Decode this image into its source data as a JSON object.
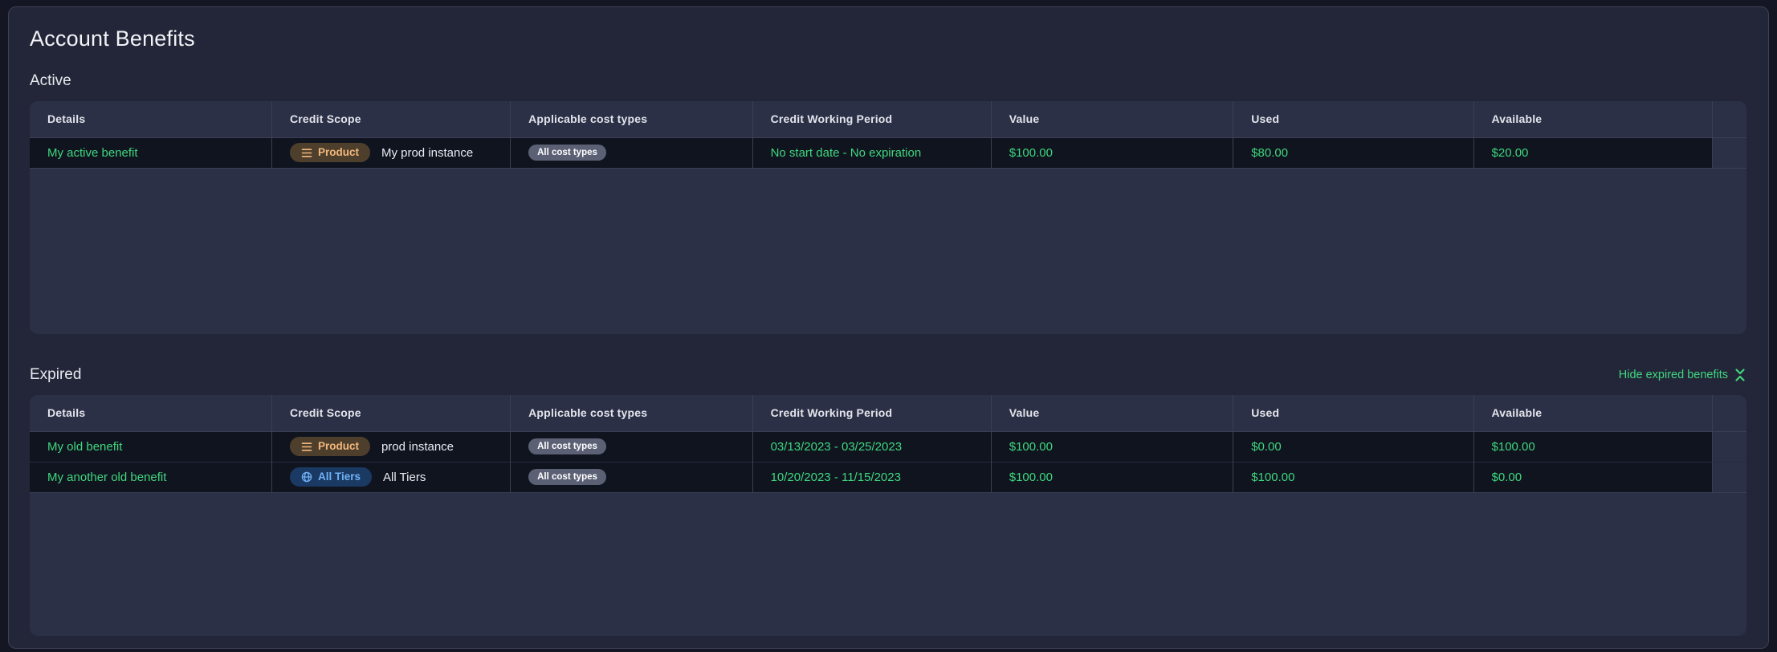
{
  "page": {
    "title": "Account Benefits"
  },
  "colors": {
    "panel_bg": "#232638",
    "card_bg": "#2c3046",
    "row_bg": "#10141f",
    "accent_green": "#3fd77e",
    "product_badge_bg": "#4e3f2c",
    "product_badge_text": "#f2b87c",
    "tiers_badge_bg": "#1b3a63",
    "tiers_badge_text": "#70b1f6",
    "cost_badge_bg": "#5c6075"
  },
  "columns": [
    "Details",
    "Credit Scope",
    "Applicable cost types",
    "Credit Working Period",
    "Value",
    "Used",
    "Available"
  ],
  "sections": {
    "active": {
      "heading": "Active",
      "rows": [
        {
          "details": "My active benefit",
          "scope_badge": "Product",
          "scope_badge_type": "product",
          "scope_text": "My prod instance",
          "cost_types": "All cost types",
          "period": "No start date - No expiration",
          "value": "$100.00",
          "used": "$80.00",
          "available": "$20.00"
        }
      ]
    },
    "expired": {
      "heading": "Expired",
      "hide_link_label": "Hide expired benefits",
      "rows": [
        {
          "details": "My old benefit",
          "scope_badge": "Product",
          "scope_badge_type": "product",
          "scope_text": "prod instance",
          "cost_types": "All cost types",
          "period": "03/13/2023 - 03/25/2023",
          "value": "$100.00",
          "used": "$0.00",
          "available": "$100.00"
        },
        {
          "details": "My another old benefit",
          "scope_badge": "All Tiers",
          "scope_badge_type": "tiers",
          "scope_text": "All Tiers",
          "cost_types": "All cost types",
          "period": "10/20/2023 - 11/15/2023",
          "value": "$100.00",
          "used": "$100.00",
          "available": "$0.00"
        }
      ]
    }
  }
}
